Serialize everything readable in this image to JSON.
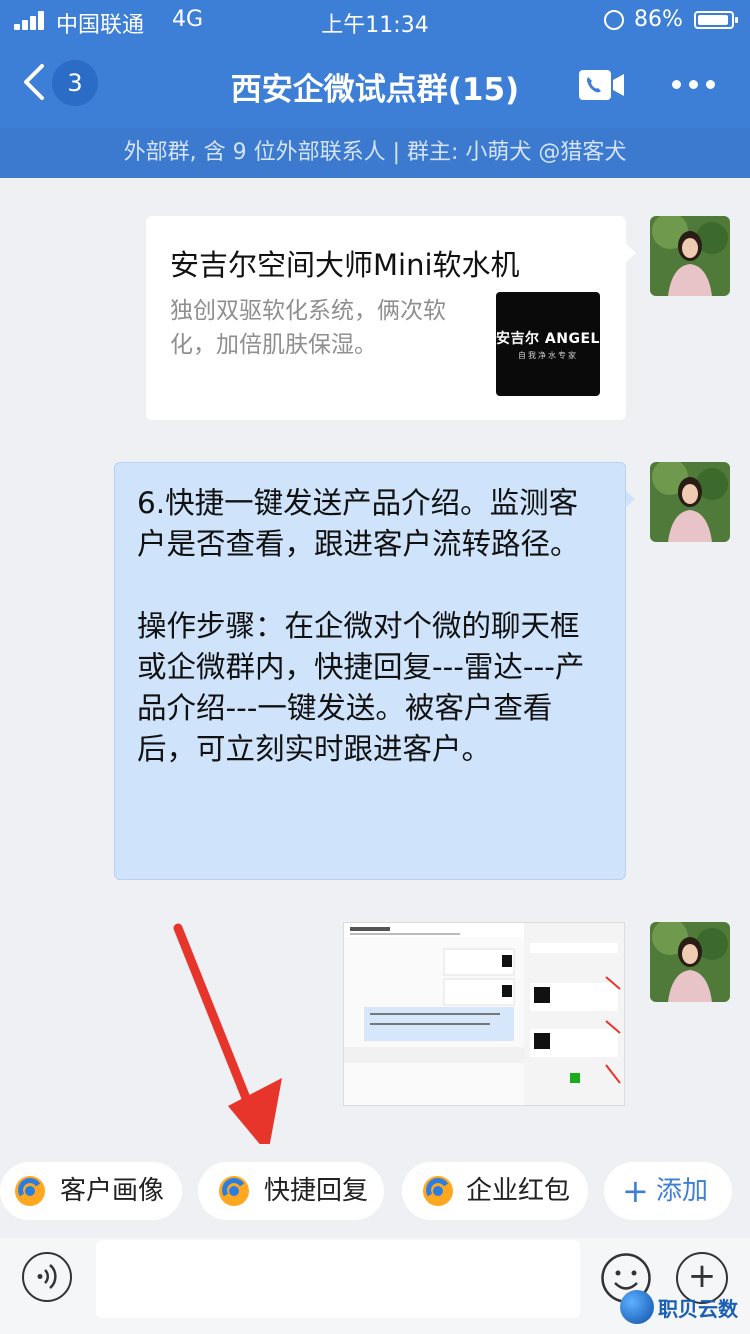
{
  "status_bar": {
    "carrier": "中国联通",
    "network": "4G",
    "time": "上午11:34",
    "battery": "86%"
  },
  "header": {
    "unread_count": "3",
    "title": "西安企微试点群(15)"
  },
  "group_info": "外部群, 含 9 位外部联系人 | 群主: 小萌犬 @猎客犬",
  "messages": {
    "card": {
      "title": "安吉尔空间大师Mini软水机",
      "description": "独创双驱软化系统，俩次软化，加倍肌肤保湿。",
      "thumb_brand": "安吉尔 ANGEL",
      "thumb_sub": "自我净水专家"
    },
    "text": "6.快捷一键发送产品介绍。监测客户是否查看，跟进客户流转路径。\n\n操作步骤：在企微对个微的聊天框或企微群内，快捷回复---雷达---产品介绍---一键发送。被客户查看后，可立刻实时跟进客户。"
  },
  "quick_actions": [
    {
      "label": "客户画像"
    },
    {
      "label": "快捷回复"
    },
    {
      "label": "企业红包"
    },
    {
      "label": "添加"
    }
  ],
  "watermark": "职贝云数",
  "colors": {
    "header_blue": "#3d7fd6",
    "bubble_blue": "#cfe3fb",
    "arrow_red": "#e8352c"
  }
}
